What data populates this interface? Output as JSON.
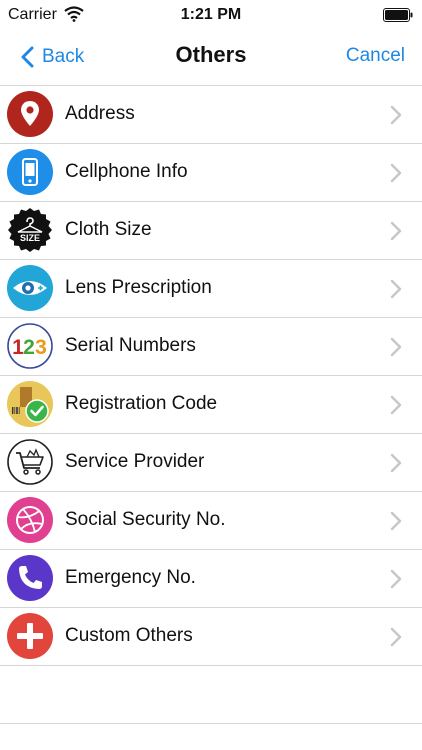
{
  "status": {
    "carrier": "Carrier",
    "time": "1:21 PM"
  },
  "nav": {
    "back_label": "Back",
    "title": "Others",
    "cancel_label": "Cancel"
  },
  "items": [
    {
      "label": "Address",
      "icon": "location-pin-icon",
      "color": "#b0261c"
    },
    {
      "label": "Cellphone Info",
      "icon": "cellphone-icon",
      "color": "#1e8ee8"
    },
    {
      "label": "Cloth Size",
      "icon": "cloth-size-icon",
      "color": "#111111"
    },
    {
      "label": "Lens Prescription",
      "icon": "eye-icon",
      "color": "#22a6d8"
    },
    {
      "label": "Serial Numbers",
      "icon": "numbers-icon",
      "color": "#ffffff"
    },
    {
      "label": "Registration Code",
      "icon": "registration-icon",
      "color": "#e8c65a"
    },
    {
      "label": "Service Provider",
      "icon": "shopping-cart-icon",
      "color": "#ffffff"
    },
    {
      "label": "Social Security No.",
      "icon": "dribbble-ball-icon",
      "color": "#e0408f"
    },
    {
      "label": "Emergency No.",
      "icon": "phone-icon",
      "color": "#5a37c8"
    },
    {
      "label": "Custom Others",
      "icon": "plus-icon",
      "color": "#e2453b"
    }
  ]
}
